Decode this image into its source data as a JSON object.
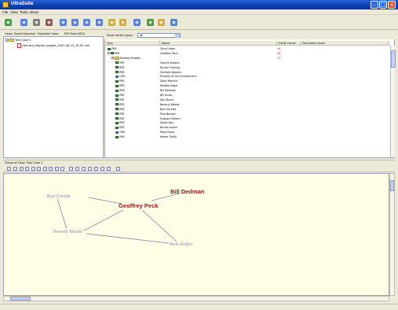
{
  "window": {
    "title": "UltraSuite"
  },
  "menu": [
    "File",
    "View",
    "Tools",
    "About"
  ],
  "toolbar_icons": [
    {
      "name": "green-node-icon",
      "color": "#2f8a2f"
    },
    {
      "name": "network-icon",
      "color": "#3a6fd0"
    },
    {
      "name": "bucket-icon",
      "color": "#6a6a6a"
    },
    {
      "name": "antenna-icon",
      "color": "#7a3f3f"
    },
    {
      "name": "cards-icon",
      "color": "#3a6fd0"
    },
    {
      "name": "zoom-in-icon",
      "color": "#3a6fd0"
    },
    {
      "name": "zoom-out-icon",
      "color": "#3a6fd0"
    },
    {
      "name": "find-icon",
      "color": "#3a6fd0"
    },
    {
      "name": "document-search-icon",
      "color": "#c9a030"
    },
    {
      "name": "people-icon",
      "color": "#c9a030"
    },
    {
      "name": "link-icon",
      "color": "#3a6fd0"
    },
    {
      "name": "refresh-icon",
      "color": "#2f8a2f"
    },
    {
      "name": "pencil-icon",
      "color": "#c9a030"
    },
    {
      "name": "tools-icon",
      "color": "#3a6fd0"
    }
  ],
  "left_tabs": [
    "Cases",
    "Saved Searches",
    "Exported Cases",
    "RSS Feed URLS"
  ],
  "tree": {
    "root": "Test Case 1",
    "child": "Gerhard_Hagner_google_2007-06-15_18-05.xml"
  },
  "filter": {
    "label": "Show entity types:",
    "value": "All"
  },
  "columns": {
    "type": "Type",
    "name": "Name",
    "count": "Entity Count",
    "document_count": "Document Count"
  },
  "rows": [
    {
      "type": "PER",
      "name": "Chris Urban",
      "count": "10",
      "indent": 0,
      "icon": "per"
    },
    {
      "type": "PER",
      "name": "Geoffrey Peck",
      "count": "20",
      "indent": 0,
      "icon": "per",
      "toggle": true
    },
    {
      "type": "Related Entities",
      "name": "",
      "count": "17",
      "indent": 1,
      "icon": "folder",
      "toggle": true
    },
    {
      "type": "PER",
      "name": "Charlie Kubeck",
      "count": "",
      "indent": 2,
      "icon": "per"
    },
    {
      "type": "PER",
      "name": "Burton Husting",
      "count": "",
      "indent": 2,
      "icon": "per"
    },
    {
      "type": "PER",
      "name": "Gerhard Wagner",
      "count": "",
      "indent": 2,
      "icon": "per"
    },
    {
      "type": "ORG",
      "name": "Ministry of the Environment",
      "count": "",
      "indent": 2,
      "icon": "org"
    },
    {
      "type": "PER",
      "name": "Dave Melnick",
      "count": "",
      "indent": 2,
      "icon": "per"
    },
    {
      "type": "PER",
      "name": "Maddie Sager",
      "count": "",
      "indent": 2,
      "icon": "per"
    },
    {
      "type": "PER",
      "name": "Bill Dedman",
      "count": "",
      "indent": 2,
      "icon": "per"
    },
    {
      "type": "PER",
      "name": "Bill Amos",
      "count": "",
      "indent": 2,
      "icon": "per"
    },
    {
      "type": "PER",
      "name": "Dan Byrne",
      "count": "",
      "indent": 2,
      "icon": "per"
    },
    {
      "type": "PER",
      "name": "Beverly Woods",
      "count": "",
      "indent": 2,
      "icon": "per"
    },
    {
      "type": "PER",
      "name": "Bert Corville",
      "count": "",
      "indent": 2,
      "icon": "per"
    },
    {
      "type": "PER",
      "name": "Paul Barbell",
      "count": "",
      "indent": 2,
      "icon": "per"
    },
    {
      "type": "PER",
      "name": "Hugues Pelbem",
      "count": "",
      "indent": 2,
      "icon": "per"
    },
    {
      "type": "PER",
      "name": "David Bau",
      "count": "",
      "indent": 2,
      "icon": "per"
    },
    {
      "type": "PER",
      "name": "Burton Ashim",
      "count": "",
      "indent": 2,
      "icon": "per"
    },
    {
      "type": "ORG",
      "name": "Mark Davis",
      "count": "",
      "indent": 2,
      "icon": "org"
    },
    {
      "type": "PER",
      "name": "Walter Smith",
      "count": "",
      "indent": 2,
      "icon": "per"
    }
  ],
  "graph": {
    "title": "Graph of Case: Test Case 1",
    "nodes": [
      {
        "id": "bill-dedman",
        "label": "Bill Dedman",
        "style": "big"
      },
      {
        "id": "geoffrey-peck",
        "label": "Geoffrey Peck",
        "style": "big"
      },
      {
        "id": "bert-corville",
        "label": "Bert Corville",
        "style": "sm"
      },
      {
        "id": "beverly-woods",
        "label": "Beverly Woods",
        "style": "sm"
      },
      {
        "id": "alvin-engler",
        "label": "Alvin Engler",
        "style": "sm"
      }
    ],
    "edge_color": "#7e86a8"
  }
}
